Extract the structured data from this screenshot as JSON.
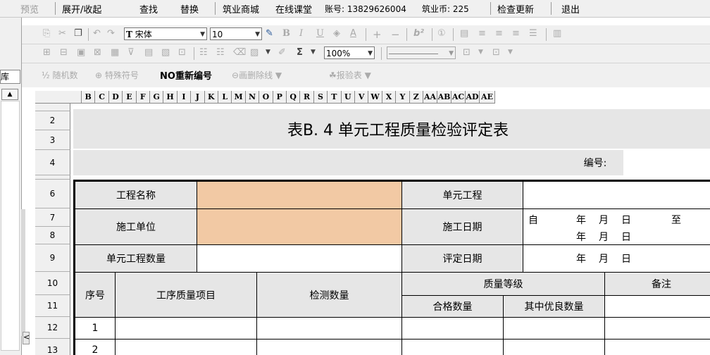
{
  "menubar": {
    "items": [
      "预览",
      "展开/收起",
      "查找",
      "替换",
      "筑业商城",
      "在线课堂",
      "账号: 13829626004",
      "筑业币: 225",
      "检查更新",
      "退出"
    ]
  },
  "leftdock": {
    "label": "库",
    "scroll_up": "▲",
    "scroll_left": "<"
  },
  "toolbar1": {
    "font_name": "宋体",
    "font_size": "10",
    "bold": "B",
    "italic": "I",
    "underline": "U",
    "font_color": "A",
    "plus": "+",
    "minus": "−",
    "superscript": "b²",
    "circled": "①"
  },
  "toolbar2": {
    "sum": "Σ",
    "zoom": "100%"
  },
  "toolbar3": {
    "random": "随机数",
    "special": "特殊符号",
    "renumber_prefix": "NO",
    "renumber": "重新编号",
    "strikethrough": "画删除线",
    "report_table": "报验表"
  },
  "columns": [
    "B",
    "C",
    "D",
    "E",
    "F",
    "G",
    "H",
    "I",
    "J",
    "K",
    "L",
    "M",
    "N",
    "O",
    "P",
    "Q",
    "R",
    "S",
    "T",
    "U",
    "V",
    "W",
    "X",
    "Y",
    "Z",
    "AA",
    "AB",
    "AC",
    "AD",
    "AE"
  ],
  "rows": [
    "",
    "2",
    "3",
    "4",
    "",
    "6",
    "7",
    "8",
    "9",
    "10",
    "11",
    "12",
    "13"
  ],
  "form": {
    "title": "表B. 4  单元工程质量检验评定表",
    "number_label": "编号:",
    "project_name": "工程名称",
    "unit_project": "单元工程",
    "construction_unit": "施工单位",
    "construction_date": "施工日期",
    "from": "自",
    "to": "至",
    "year": "年",
    "month": "月",
    "day": "日",
    "unit_count": "单元工程数量",
    "assess_date": "评定日期",
    "col_seq": "序号",
    "col_item": "工序质量项目",
    "col_count": "检测数量",
    "col_grade": "质量等级",
    "col_note": "备注",
    "col_pass": "合格数量",
    "col_excellent": "其中优良数量",
    "row1": "1",
    "row2": "2"
  }
}
